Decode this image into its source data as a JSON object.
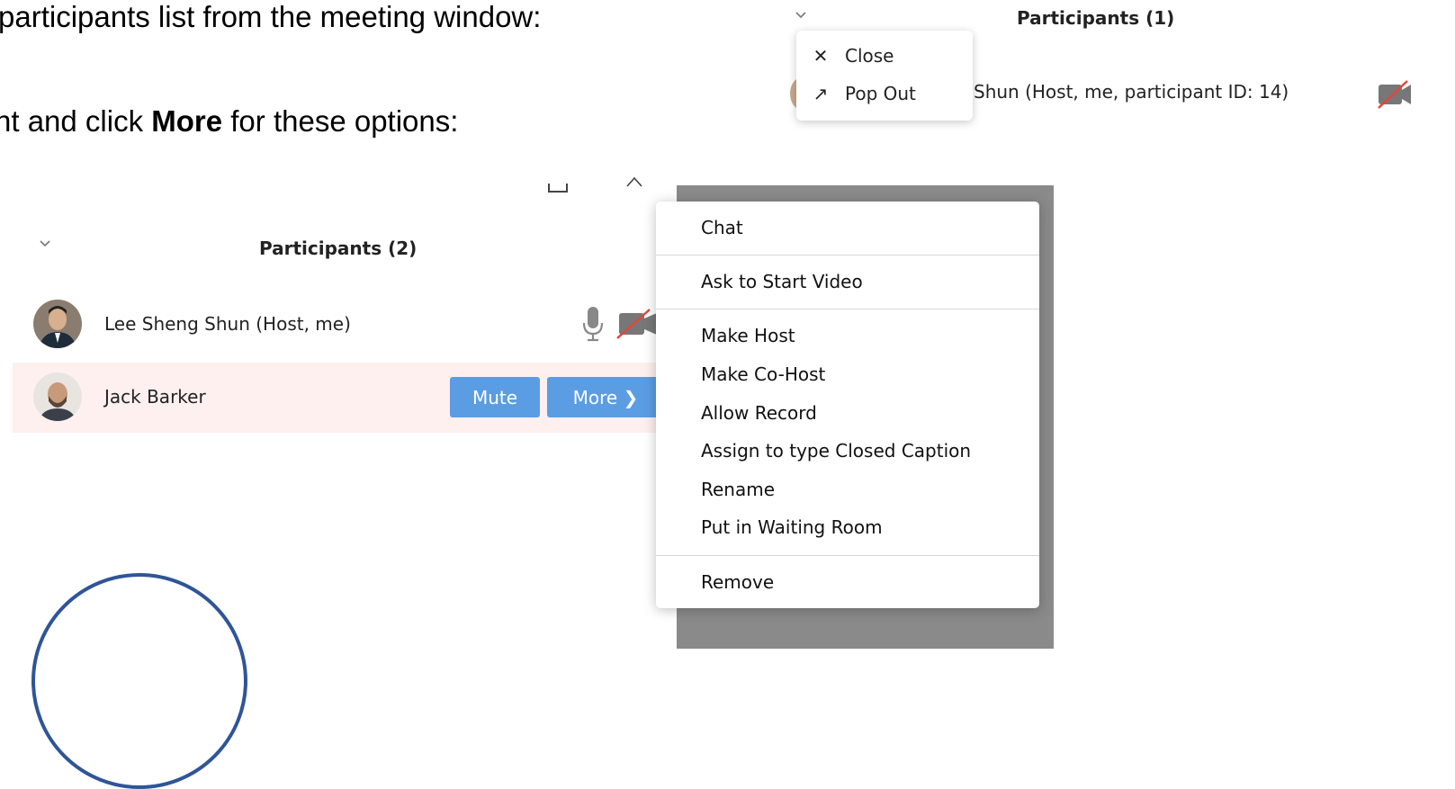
{
  "slide": {
    "line1": "participants list from the meeting window:",
    "line2_prefix": "nt and click ",
    "line2_bold": "More",
    "line2_suffix": " for these options:"
  },
  "top_panel": {
    "title": "Participants (1)",
    "participant_text": "Shun (Host, me, participant ID: 14)",
    "menu": {
      "close_label": "Close",
      "close_icon": "✕",
      "popout_label": "Pop Out",
      "popout_icon": "↗"
    }
  },
  "main_panel": {
    "title": "Participants (2)",
    "participants": [
      {
        "name": "Lee Sheng Shun (Host, me)"
      },
      {
        "name": "Jack Barker",
        "mute_label": "Mute",
        "more_label": "More ❯"
      }
    ]
  },
  "context_menu": {
    "items": [
      "Chat",
      "Ask to Start Video",
      "Make Host",
      "Make Co-Host",
      "Allow Record",
      "Assign to type Closed Caption",
      "Rename",
      "Put in Waiting Room",
      "Remove"
    ]
  },
  "colors": {
    "button_blue": "#5b9de3",
    "highlight_row": "#fdf0ef",
    "camera_off_red": "#e0473a",
    "circle_blue": "#2f5597"
  }
}
